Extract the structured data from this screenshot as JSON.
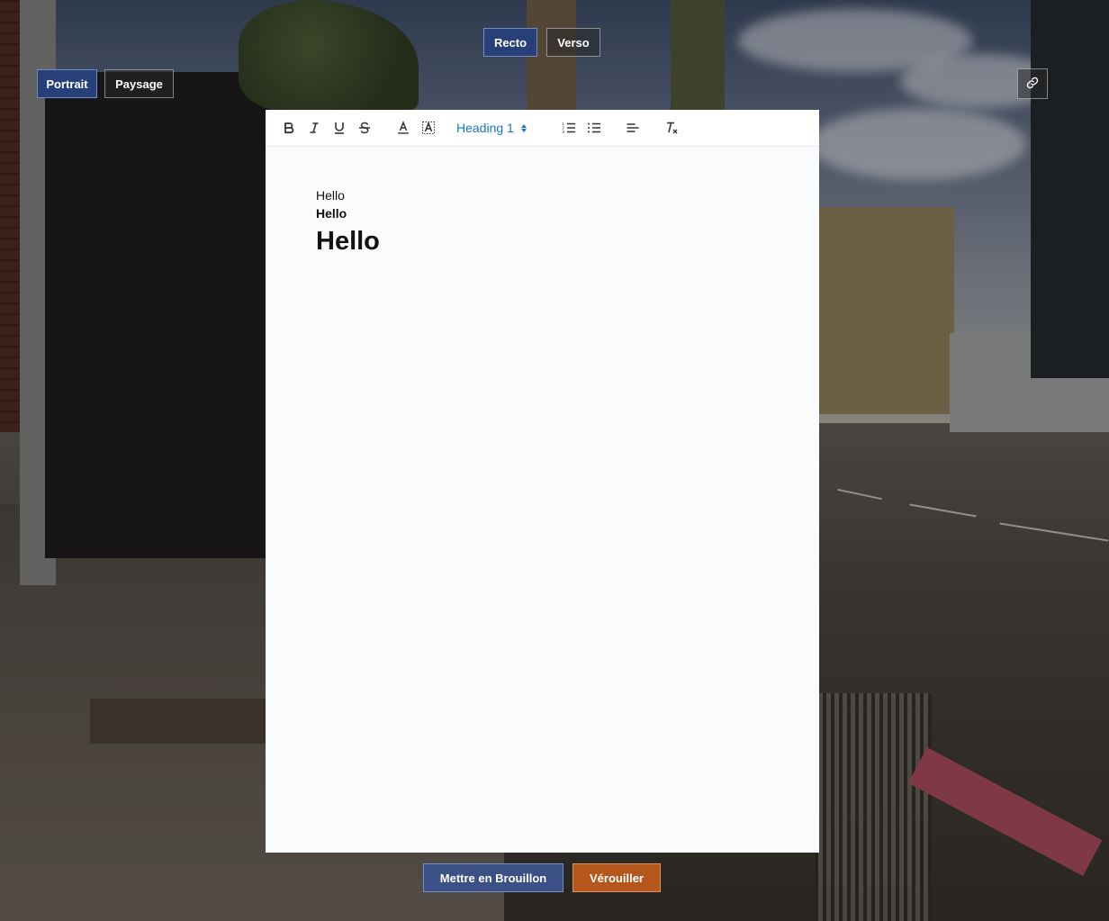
{
  "face_tabs": {
    "recto": "Recto",
    "verso": "Verso",
    "active": "recto"
  },
  "orientation": {
    "portrait": "Portrait",
    "paysage": "Paysage",
    "active": "portrait"
  },
  "link_button": {
    "icon": "link-icon"
  },
  "toolbar": {
    "buttons": [
      "bold-icon",
      "italic-icon",
      "underline-icon",
      "strikethrough-icon",
      "text-color-icon",
      "highlight-icon",
      "ordered-list-icon",
      "bullet-list-icon",
      "align-left-icon",
      "clear-format-icon"
    ],
    "heading_value": "Heading 1"
  },
  "document": {
    "line_normal": "Hello",
    "line_bold": "Hello",
    "line_heading": "Hello"
  },
  "actions": {
    "draft": "Mettre en Brouillon",
    "lock": "Vérouiller"
  },
  "colors": {
    "active_tab": "#27407a",
    "draft_button": "#3b5185",
    "lock_button": "#b5561c",
    "heading_select": "#1a73c8"
  }
}
